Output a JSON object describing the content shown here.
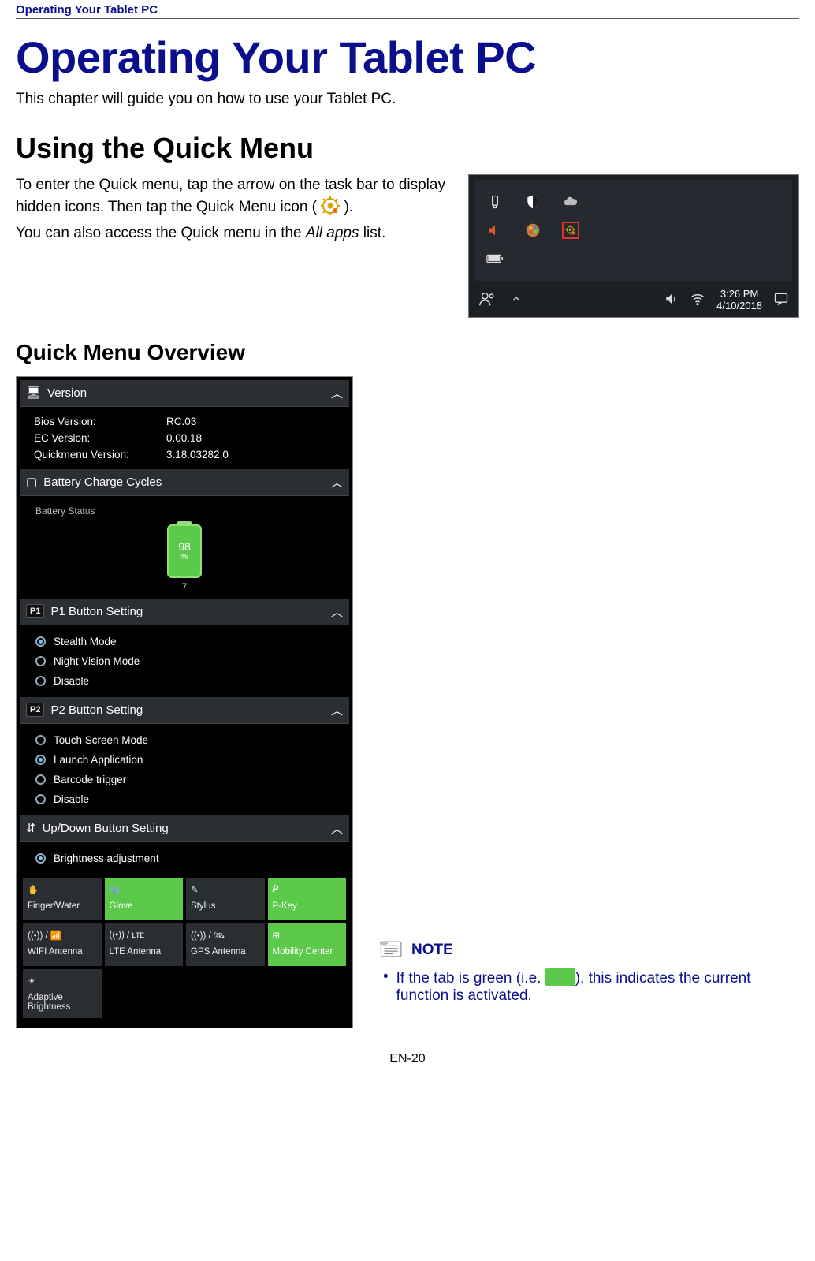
{
  "runningHeader": "Operating Your Tablet PC",
  "pageTitle": "Operating Your Tablet PC",
  "intro": "This chapter will guide you on how to use your Tablet PC.",
  "section1": {
    "heading": "Using the Quick Menu",
    "para1a": "To enter the Quick menu, tap the arrow on the task bar to display hidden icons. Then tap the Quick Menu icon (",
    "para1b": ").",
    "para2a": "You can also access the Quick menu in the ",
    "para2em": "All apps",
    "para2b": " list."
  },
  "taskbar": {
    "clockTime": "3:26 PM",
    "clockDate": "4/10/2018"
  },
  "subsectionHeading": "Quick Menu Overview",
  "qm": {
    "version": {
      "title": "Version",
      "rows": [
        {
          "k": "Bios Version:",
          "v": "RC.03"
        },
        {
          "k": "EC Version:",
          "v": "0.00.18"
        },
        {
          "k": "Quickmenu Version:",
          "v": "3.18.03282.0"
        }
      ]
    },
    "battery": {
      "title": "Battery Charge Cycles",
      "statusLabel": "Battery Status",
      "percent": "98",
      "percentUnit": "%",
      "cycle": "7"
    },
    "p1": {
      "badge": "P1",
      "title": "P1 Button Setting",
      "options": [
        {
          "label": "Stealth Mode",
          "sel": true
        },
        {
          "label": "Night Vision Mode",
          "sel": false
        },
        {
          "label": "Disable",
          "sel": false
        }
      ]
    },
    "p2": {
      "badge": "P2",
      "title": "P2 Button Setting",
      "options": [
        {
          "label": "Touch Screen Mode",
          "sel": false
        },
        {
          "label": "Launch Application",
          "sel": true
        },
        {
          "label": "Barcode trigger",
          "sel": false
        },
        {
          "label": "Disable",
          "sel": false
        }
      ]
    },
    "updown": {
      "title": "Up/Down Button Setting",
      "options": [
        {
          "label": "Brightness adjustment",
          "sel": true
        }
      ]
    },
    "tiles": [
      {
        "label": "Finger/Water",
        "active": false
      },
      {
        "label": "Glove",
        "active": true
      },
      {
        "label": "Stylus",
        "active": false
      },
      {
        "label": "P-Key",
        "active": true
      },
      {
        "label": "WIFI Antenna",
        "active": false
      },
      {
        "label": "LTE Antenna",
        "active": false
      },
      {
        "label": "GPS Antenna",
        "active": false
      },
      {
        "label": "Mobility Center",
        "active": true
      },
      {
        "label": "Adaptive Brightness",
        "active": false
      }
    ]
  },
  "note": {
    "label": "NOTE",
    "text_a": "If the tab is green (i.e. ",
    "text_b": "), this indicates the current function is activated."
  },
  "footer": "EN-20"
}
